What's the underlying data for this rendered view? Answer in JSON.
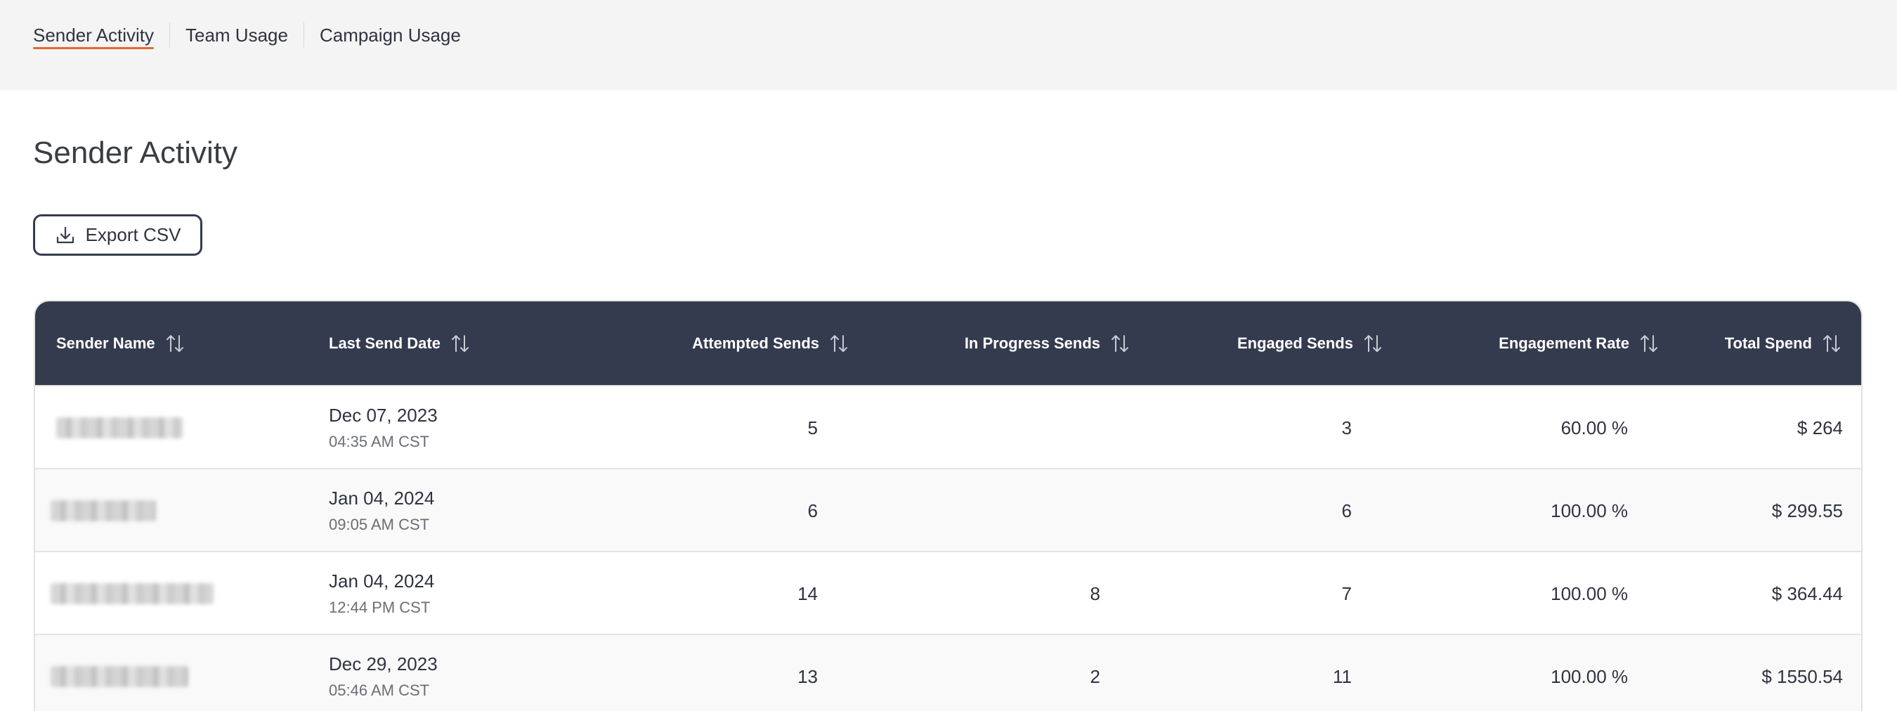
{
  "tabs": [
    {
      "label": "Sender Activity",
      "active": true
    },
    {
      "label": "Team Usage",
      "active": false
    },
    {
      "label": "Campaign Usage",
      "active": false
    }
  ],
  "page": {
    "title": "Sender Activity"
  },
  "toolbar": {
    "export_label": "Export CSV",
    "export_icon": "download-icon"
  },
  "table": {
    "headers": [
      "Sender Name",
      "Last Send Date",
      "Attempted Sends",
      "In Progress Sends",
      "Engaged Sends",
      "Engagement Rate",
      "Total Spend"
    ],
    "sort_icon": "sort-arrows-icon",
    "rows": [
      {
        "date": "Dec 07, 2023",
        "time": "04:35 AM CST",
        "attempted": "5",
        "in_progress": "",
        "engaged": "3",
        "rate": "60.00 %",
        "spend": "$ 264"
      },
      {
        "date": "Jan 04, 2024",
        "time": "09:05 AM CST",
        "attempted": "6",
        "in_progress": "",
        "engaged": "6",
        "rate": "100.00 %",
        "spend": "$ 299.55"
      },
      {
        "date": "Jan 04, 2024",
        "time": "12:44 PM CST",
        "attempted": "14",
        "in_progress": "8",
        "engaged": "7",
        "rate": "100.00 %",
        "spend": "$ 364.44"
      },
      {
        "date": "Dec 29, 2023",
        "time": "05:46 AM CST",
        "attempted": "13",
        "in_progress": "2",
        "engaged": "11",
        "rate": "100.00 %",
        "spend": "$ 1550.54"
      }
    ]
  },
  "colors": {
    "accent": "#e8672a",
    "header_bg": "#343b4e",
    "topbar_bg": "#f4f4f4"
  }
}
